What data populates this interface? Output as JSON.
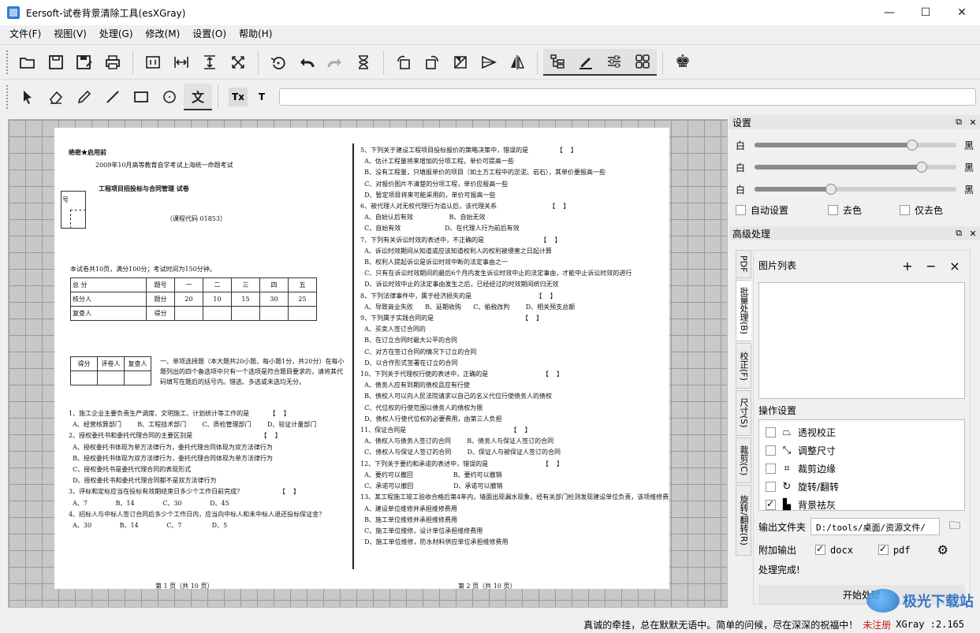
{
  "window": {
    "title": "Eersoft-试卷背景清除工具(esXGray)",
    "minimize": "—",
    "maximize": "☐",
    "close": "✕"
  },
  "menu": [
    "文件(F)",
    "视图(V)",
    "处理(G)",
    "修改(M)",
    "设置(O)",
    "帮助(H)"
  ],
  "toolbar1": {
    "groups": [
      [
        "open-icon",
        "save-icon",
        "save-as-icon",
        "print-icon"
      ],
      [
        "fit-page-icon",
        "fit-width-icon",
        "fit-height-icon",
        "fullscreen-icon"
      ],
      [
        "rotate-icon",
        "undo-icon",
        "redo-icon",
        "hourglass-icon"
      ],
      [
        "rotate-left-icon",
        "rotate-right-icon",
        "deskew-icon",
        "flip-vertical-icon",
        "flip-horizontal-icon"
      ],
      [
        "tree-icon",
        "pen-tool-icon",
        "sliders-icon",
        "grid-icon"
      ],
      [
        "chess-king-icon"
      ]
    ]
  },
  "toolbar2": {
    "tools": [
      "select-icon",
      "eraser-icon",
      "pencil-icon",
      "line-icon",
      "rectangle-icon",
      "circle-icon",
      "text-icon"
    ],
    "text_buttons": [
      "Tx",
      "T"
    ]
  },
  "settings": {
    "title": "设置",
    "sliders": [
      {
        "left": "白",
        "right": "黑",
        "value": 0.78
      },
      {
        "left": "白",
        "right": "黑",
        "value": 0.83
      },
      {
        "left": "白",
        "right": "黑",
        "value": 0.38
      }
    ],
    "checks": [
      {
        "label": "自动设置",
        "checked": false
      },
      {
        "label": "去色",
        "checked": false
      },
      {
        "label": "仅去色",
        "checked": false
      }
    ]
  },
  "advanced": {
    "title": "高级处理",
    "tabs": [
      "PDF",
      "批量处理(B)",
      "校正(F)",
      "尺寸(S)",
      "裁剪(C)",
      "旋转/翻转(R)"
    ],
    "active_tab": 1,
    "image_list_label": "图片列表",
    "add": "+",
    "remove": "−",
    "clear": "×",
    "ops_label": "操作设置",
    "ops": [
      {
        "icon": "perspective-icon",
        "label": "透视校正",
        "checked": false
      },
      {
        "icon": "resize-icon",
        "label": "调整尺寸",
        "checked": false
      },
      {
        "icon": "crop-icon",
        "label": "裁剪边缘",
        "checked": false
      },
      {
        "icon": "rotate-icon",
        "label": "旋转/翻转",
        "checked": false
      },
      {
        "icon": "paint-roller-icon",
        "label": "背景祛灰",
        "checked": true
      }
    ],
    "output_label": "输出文件夹",
    "output_path": "D:/tools/桌面/资源文件/",
    "extra_label": "附加输出",
    "extra_docx": "docx",
    "extra_pdf": "pdf",
    "done_text": "处理完成!",
    "start_button": "开始处理"
  },
  "status": {
    "message": "真诚的牵挂，总在默默无语中。简单的问候，尽在深深的祝福中！",
    "register": "未注册",
    "version": "XGray :2.165"
  },
  "watermark": "极光下载站",
  "paper": {
    "secret": "绝密★启用前",
    "heading1": "2009年10月高等教育自学考试上海统一命题考试",
    "heading2": "工程项目招投标与合同管理   试卷",
    "course_code": "（课程代码  01853）",
    "num_label": "号",
    "info": "本试卷共10页，满分100分；考试时间为150分钟。",
    "score_table": [
      [
        "总  分",
        "题号",
        "一",
        "二",
        "三",
        "四",
        "五"
      ],
      [
        "核分人",
        "题分",
        "20",
        "10",
        "15",
        "30",
        "25"
      ],
      [
        "复查人",
        "得分",
        "",
        "",
        "",
        "",
        ""
      ]
    ],
    "grader_table": [
      [
        "得分",
        "评卷人",
        "复查人"
      ],
      [
        "",
        "",
        ""
      ]
    ],
    "section1": "一、单项选择题（本大题共20小题，每小题1分，共20分）在每小题列出的四个备选项中只有一个选项是符合题目要求的，请将其代码填写在题后的括号内。错选、多选或未选均无分。",
    "left_questions": "1、施工企业主要负责生产调度、文明施工、计划统计等工作的是          【    】\n  A、经营核算部门        B、工程技术部门        C、质检管理部门        D、验证计量部门\n2、授权委托书和委托代理合同的主要区别是                                  【    】\n  A、授权委托书体现为单方法律行为，委托代理合同体现为双方法律行为\n  B、授权委托书体现为双方法律行为，委托代理合同体现为单方法律行为\n  C、授权委托书是委托代理合同的表现形式\n  D、授权委托书和委托代理合同都不是双方法律行为\n3、评标和定标应当在投标有效期结束日多少个工作日前完成？                  【    】\n  A、7              B、14              C、30              D、45\n4、招标人与中标人签订合同后多少个工作日内，应当向中标人和未中标人退还投标保证金？\n  A、30              B、14              C、7               D、5",
    "right_questions": "5、下列关于建设工程项目投标报价的策略决策中，错误的是              【    】\n  A、估计工程量将来增加的分项工程，单价可提高一些\n  B、没有工程量，只填报单价的项目（如土方工程中的淤泥、岩石），其单价要报高一些\n  C、对报价图片不清楚的分项工程，单价应报高一些\n  D、暂定项目将来可能采用的，单价可报高一些\n6、被代理人对无权代理行为追认后，该代理关系                          【    】\n  A、自始认后有效                  B、自始无效\n  C、自始有效                      D、在代理人行为前后有效\n7、下列有关诉讼时效的表述中，不正确的是                            【    】\n  A、诉讼时效期间从知道或应该知道权利人的权利被侵害之日起计算\n  B、权利人提起诉讼是诉讼时效中断的法定事由之一\n  C、只有在诉讼时效期间的最后6个月内发生诉讼时效中止的法定事由，才能中止诉讼时效的进行\n  D、诉讼时效中止的法定事由发生之后，已经经过的时效期间统归无效\n8、下列法律事件中，属于经济损失的是                                【    】\n  A、导致商业失败      B、延期收购      C、偷税改判        D、相关预支总额\n9、下列属于实践合同的是                                            【    】\n  A、买卖人签订合同的\n  B、在订立合同时最大公平的合同\n  C、对方在签订合同的情况下订立的合同\n  D、以合作形式签署在订立的合同\n10、下列关于代理权行使的表述中，正确的是                           【    】\n  A、债务人应有到期的债权且应有行使\n  B、债权人可以向人民法院请求以自己的名义代位行使债务人的债权\n  C、代位权的行使范围以债务人的债权为限\n  D、债权人行使代位权的必要费用，由第三人负担\n11、保证合同是                                                    【    】\n  A、债权人与债务人签订的合同        B、债务人与保证人签订的合同\n  C、债权人与保证人签订的合同        D、保证人与被保证人签订的合同\n12、下列关于要约和承诺的表述中，错误的是                           【    】\n  A、要约可以撤回                    B、要约可以撤销\n  C、承诺可以撤回                    D、承诺可以撤销\n13、某工程施工竣工验收合格后第4年内，墙面出现漏水现象，经有关部门检测发现建设单位负责，该项维修费用应当由 【    】\n  A、建设单位维修并承担维修费用\n  B、施工单位维修并承担维修费用\n  C、施工单位维修，设计单位承担维修费用\n  D、施工单位维修，防水材料供应单位承担维修费用",
    "footer_left": "第 1 页（共 10 页）",
    "footer_right": "第 2 页（共 10 页）"
  }
}
